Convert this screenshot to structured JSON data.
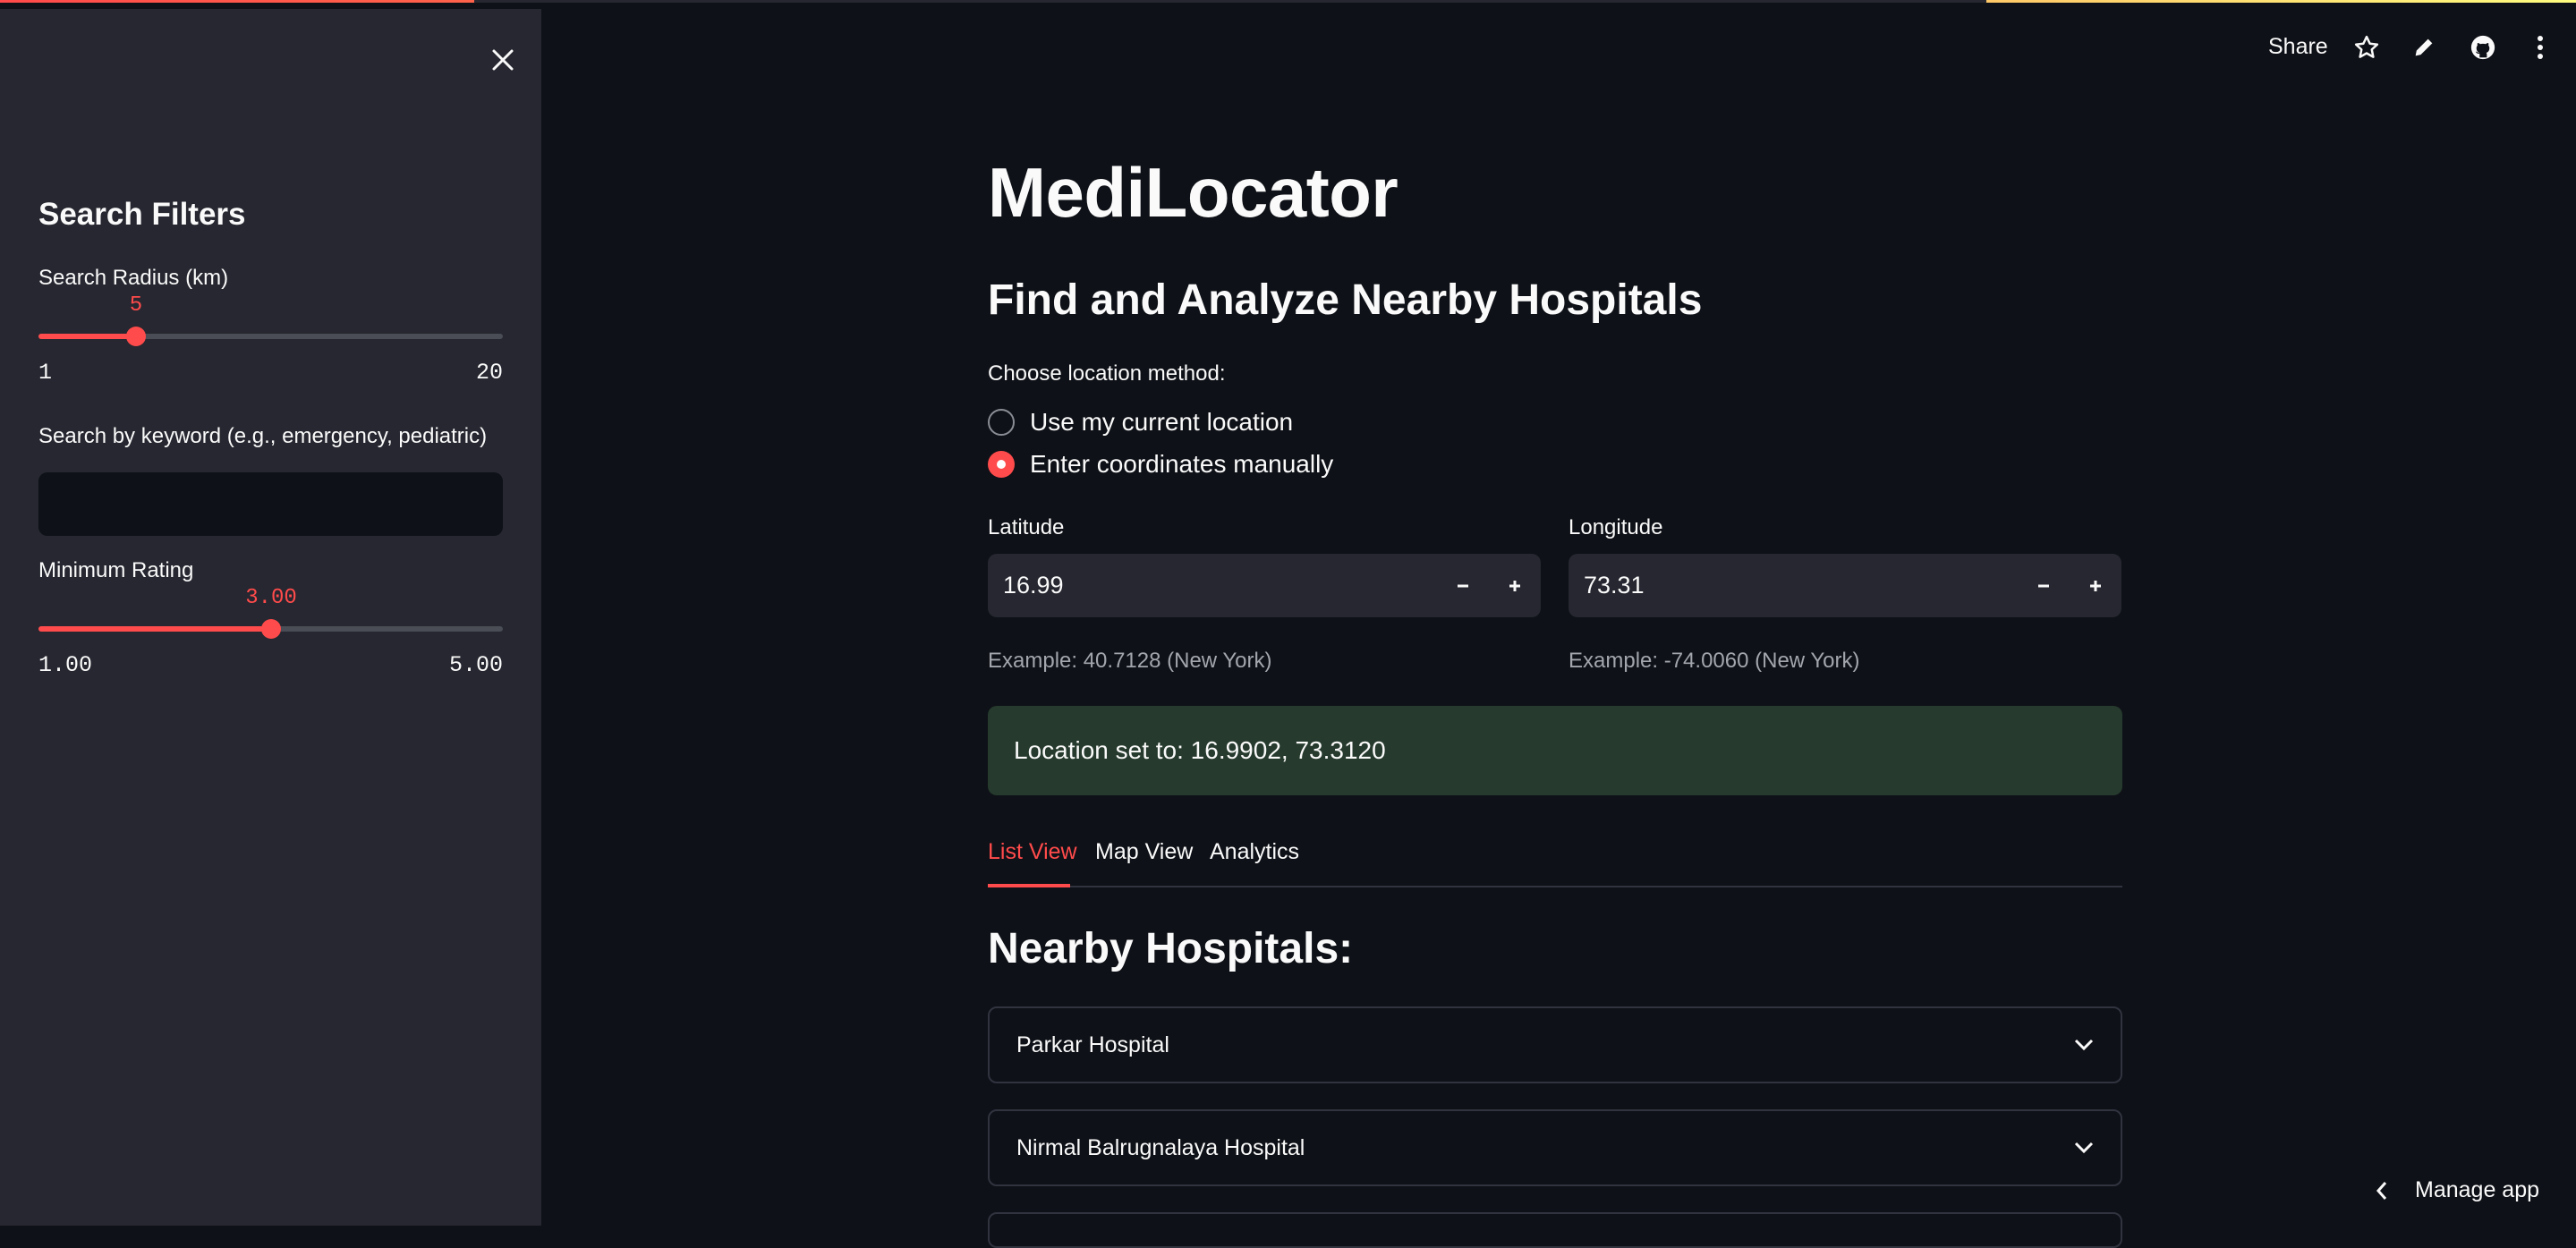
{
  "sidebar": {
    "title": "Search Filters",
    "radius": {
      "label": "Search Radius (km)",
      "value": "5",
      "min": "1",
      "max": "20",
      "fraction": 0.2105
    },
    "keyword": {
      "label": "Search by keyword (e.g., emergency, pediatric)",
      "value": ""
    },
    "rating": {
      "label": "Minimum Rating",
      "value": "3.00",
      "min": "1.00",
      "max": "5.00",
      "fraction": 0.5
    }
  },
  "toolbar": {
    "share_label": "Share"
  },
  "main": {
    "title": "MediLocator",
    "subtitle": "Find and Analyze Nearby Hospitals",
    "location_method": {
      "label": "Choose location method:",
      "options": [
        "Use my current location",
        "Enter coordinates manually"
      ],
      "selected": "Enter coordinates manually"
    },
    "latitude": {
      "label": "Latitude",
      "value": "16.99",
      "help": "Example: 40.7128 (New York)"
    },
    "longitude": {
      "label": "Longitude",
      "value": "73.31",
      "help": "Example: -74.0060 (New York)"
    },
    "status": "Location set to: 16.9902, 73.3120",
    "tabs": [
      "List View",
      "Map View",
      "Analytics"
    ],
    "active_tab": "List View",
    "list_heading": "Nearby Hospitals:",
    "hospitals": [
      "Parkar Hospital",
      "Nirmal Balrugnalaya Hospital"
    ]
  },
  "footer": {
    "manage_app_label": "Manage app"
  },
  "colors": {
    "accent": "#ff4b4b",
    "background": "#0e1117",
    "sidebar": "#262730",
    "success_bg": "#263a2d"
  }
}
